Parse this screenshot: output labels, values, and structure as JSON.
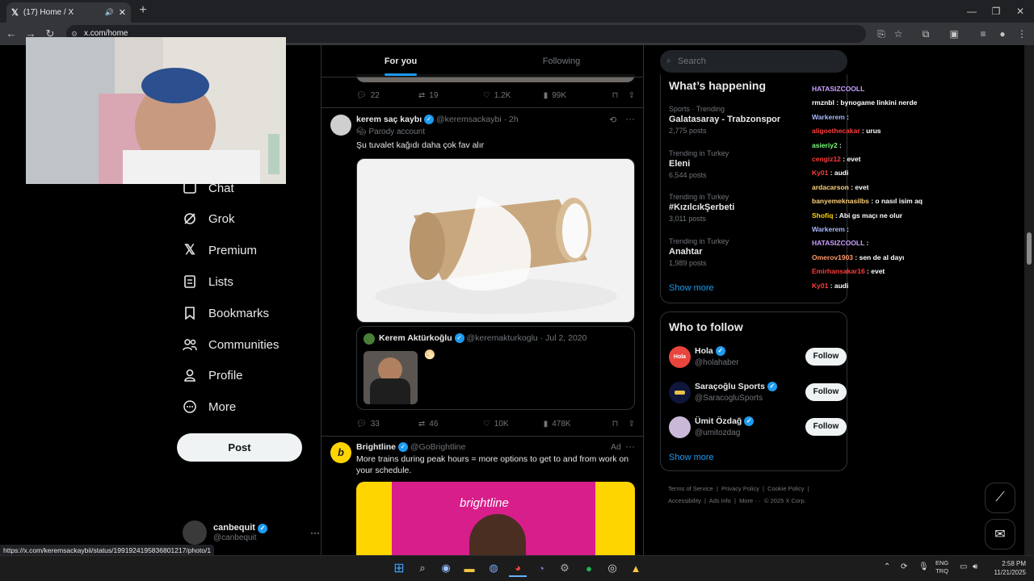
{
  "browser": {
    "tab_title": "(17) Home / X",
    "url": "x.com/home",
    "status_url": "https://x.com/keremsackaybii/status/1991924195836801217/photo/1"
  },
  "nav": {
    "items": [
      {
        "label": "Chat",
        "icon": "chat-icon"
      },
      {
        "label": "Grok",
        "icon": "grok-icon"
      },
      {
        "label": "Premium",
        "icon": "x-logo-icon"
      },
      {
        "label": "Lists",
        "icon": "lists-icon"
      },
      {
        "label": "Bookmarks",
        "icon": "bookmark-icon"
      },
      {
        "label": "Communities",
        "icon": "communities-icon"
      },
      {
        "label": "Profile",
        "icon": "profile-icon"
      },
      {
        "label": "More",
        "icon": "more-circle-icon"
      }
    ],
    "post_label": "Post",
    "account": {
      "name": "canbequit",
      "handle": "@canbequit",
      "more": "···"
    }
  },
  "feed": {
    "tabs": [
      "For you",
      "Following"
    ],
    "top_actions": {
      "replies": "22",
      "reposts": "19",
      "likes": "1.2K",
      "views": "99K"
    },
    "post1": {
      "name": "kerem saç kaybı",
      "handle": "@keremsackaybi",
      "time": "· 2h",
      "parody": "Parody account",
      "text": "Şu tuvalet kağıdı daha çok fav alır",
      "quote": {
        "name": "Kerem Aktürkoğlu",
        "handle": "@keremakturkoglu",
        "time": "· Jul 2, 2020",
        "emoji": "🌕"
      },
      "actions": {
        "replies": "33",
        "reposts": "46",
        "likes": "10K",
        "views": "478K"
      }
    },
    "post2": {
      "name": "Brightline",
      "handle": "@GoBrightline",
      "ad": "Ad",
      "text": "More trains during peak hours = more options to get to and from work on your schedule.",
      "logo_letter": "b",
      "banner_text": "brightline"
    }
  },
  "right": {
    "search_placeholder": "Search",
    "happening_title": "What’s happening",
    "trends": [
      {
        "context": "Sports · Trending",
        "name": "Galatasaray - Trabzonspor",
        "count": "2,775 posts"
      },
      {
        "context": "Trending in Turkey",
        "name": "Eleni",
        "count": "6,544 posts"
      },
      {
        "context": "Trending in Turkey",
        "name": "#KızılcıkŞerbeti",
        "count": "3,011 posts"
      },
      {
        "context": "Trending in Turkey",
        "name": "Anahtar",
        "count": "1,989 posts"
      }
    ],
    "show_more": "Show more",
    "who_title": "Who to follow",
    "follow_label": "Follow",
    "accounts": [
      {
        "name": "Hola",
        "handle": "@holahaber",
        "color": "#e8453c",
        "avatar_text": "Hola"
      },
      {
        "name": "Saraçoğlu Sports",
        "handle": "@SaracogluSports",
        "color": "#10163a",
        "avatar_text": ""
      },
      {
        "name": "Ümit Özdağ",
        "handle": "@umitozdag",
        "color": "#c9b8d8",
        "avatar_text": ""
      }
    ],
    "footer": [
      "Terms of Service",
      "|",
      "Privacy Policy",
      "|",
      "Cookie Policy",
      "|",
      "Accessibility",
      "|",
      "Ads info",
      "|",
      "More ···",
      "© 2025 X Corp."
    ]
  },
  "chat": [
    {
      "user": "HATASIZCOOLL",
      "color": "#c9a0ff",
      "msg": ""
    },
    {
      "user": "rmznbl",
      "color": "#ffffff",
      "msg": ": bynogame linkini nerde"
    },
    {
      "user": "Warkerem",
      "color": "#a8b8ff",
      "msg": ":"
    },
    {
      "user": "aligoethecakar",
      "color": "#ff3b3b",
      "msg": ": urus"
    },
    {
      "user": "asieriy2",
      "color": "#7cff7c",
      "msg": ":"
    },
    {
      "user": "cengiz12",
      "color": "#ff3b3b",
      "msg": ": evet"
    },
    {
      "user": "Ky01",
      "color": "#ff3b3b",
      "msg": ": audi"
    },
    {
      "user": "ardacarson",
      "color": "#ffd17a",
      "msg": ": evet"
    },
    {
      "user": "banyemeknasilbs",
      "color": "#ffd17a",
      "msg": ": o nasıl isim aq"
    },
    {
      "user": "Shofiq",
      "color": "#ffd700",
      "msg": ": Abi gs maçı ne olur"
    },
    {
      "user": "Warkerem",
      "color": "#a8b8ff",
      "msg": ":"
    },
    {
      "user": "HATASIZCOOLL",
      "color": "#c9a0ff",
      "msg": ":"
    },
    {
      "user": "Omerov1903",
      "color": "#ff9a6b",
      "msg": ": sen de al dayı"
    },
    {
      "user": "Emirhansakar16",
      "color": "#ff3b3b",
      "msg": ": evet"
    },
    {
      "user": "Ky01",
      "color": "#ff3b3b",
      "msg": ": audi"
    }
  ],
  "taskbar": {
    "lang": "ENG",
    "lang2": "TRQ",
    "time": "2:58 PM",
    "date": "11/21/2025"
  }
}
